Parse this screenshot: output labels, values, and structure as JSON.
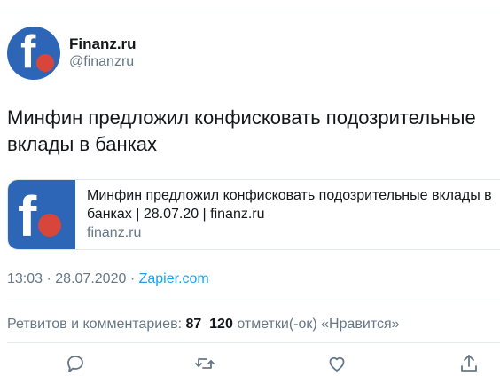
{
  "author": {
    "name": "Finanz.ru",
    "handle": "@finanzru",
    "avatar_letter": "f",
    "brand_color": "#2d66b6",
    "dot_color": "#d8453a"
  },
  "tweet": {
    "text": "Минфин предложил конфисковать подозрительные вклады в банках"
  },
  "card": {
    "thumb_letter": "f",
    "title": "Минфин предложил конфисковать подозрительные вклады в банках | 28.07.20 | finanz.ru",
    "domain": "finanz.ru"
  },
  "meta": {
    "time": "13:03",
    "separator": "·",
    "date": "28.07.2020",
    "source": "Zapier.com",
    "source_color": "#1da1f2"
  },
  "stats": {
    "retweets_label": "Ретвитов и комментариев:",
    "retweets_count": "87",
    "likes_count": "120",
    "likes_label": "отметки(-ок) «Нравится»"
  },
  "actions": {
    "reply_icon": "reply-icon",
    "retweet_icon": "retweet-icon",
    "like_icon": "heart-icon",
    "share_icon": "share-icon",
    "icon_color": "#657786"
  }
}
